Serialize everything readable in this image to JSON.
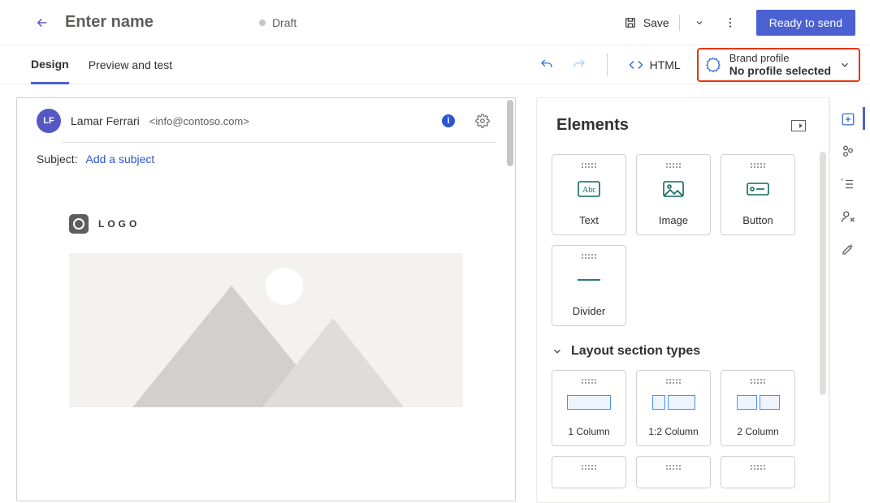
{
  "header": {
    "title": "Enter name",
    "status": "Draft",
    "save_label": "Save",
    "primary_label": "Ready to send"
  },
  "toolbar": {
    "tabs": [
      "Design",
      "Preview and test"
    ],
    "html_label": "HTML",
    "brand": {
      "label": "Brand profile",
      "value": "No profile selected"
    }
  },
  "canvas": {
    "avatar_initials": "LF",
    "from_name": "Lamar Ferrari",
    "from_email": "<info@contoso.com>",
    "subject_label": "Subject:",
    "subject_link": "Add a subject",
    "logo_text": "LOGO"
  },
  "panel": {
    "title": "Elements",
    "tiles": [
      "Text",
      "Image",
      "Button",
      "Divider"
    ],
    "section_label": "Layout section types",
    "layouts": [
      "1 Column",
      "1:2 Column",
      "2 Column"
    ]
  }
}
